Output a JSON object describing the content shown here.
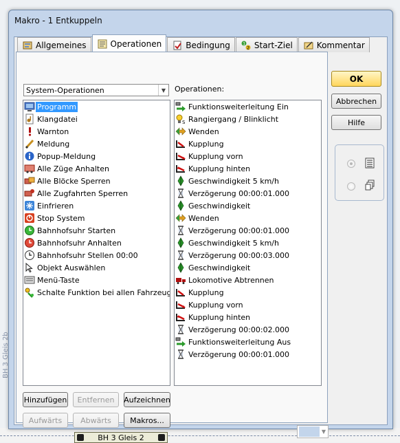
{
  "window": {
    "title": "Makro - 1 Entkuppeln"
  },
  "tabs": [
    {
      "label": "Allgemeines",
      "icon": "general-icon"
    },
    {
      "label": "Operationen",
      "icon": "operations-icon",
      "active": true
    },
    {
      "label": "Bedingung",
      "icon": "condition-icon"
    },
    {
      "label": "Start-Ziel",
      "icon": "start-destination-icon"
    },
    {
      "label": "Kommentar",
      "icon": "comment-icon"
    }
  ],
  "category_select": {
    "value": "System-Operationen"
  },
  "operations_label": "Operationen:",
  "system_operations": [
    {
      "label": "Programm",
      "icon": "program-icon",
      "selected": true
    },
    {
      "label": "Klangdatei",
      "icon": "sound-file-icon"
    },
    {
      "label": "Warnton",
      "icon": "warning-tone-icon"
    },
    {
      "label": "Meldung",
      "icon": "message-icon"
    },
    {
      "label": "Popup-Meldung",
      "icon": "popup-message-icon"
    },
    {
      "label": "Alle Züge Anhalten",
      "icon": "stop-all-trains-icon"
    },
    {
      "label": "Alle Blöcke Sperren",
      "icon": "lock-all-blocks-icon"
    },
    {
      "label": "Alle Zugfahrten Sperren",
      "icon": "lock-all-routes-icon"
    },
    {
      "label": "Einfrieren",
      "icon": "freeze-icon"
    },
    {
      "label": "Stop System",
      "icon": "stop-system-icon"
    },
    {
      "label": "Bahnhofsuhr Starten",
      "icon": "clock-start-icon"
    },
    {
      "label": "Bahnhofsuhr Anhalten",
      "icon": "clock-stop-icon"
    },
    {
      "label": "Bahnhofsuhr Stellen 00:00",
      "icon": "clock-set-icon"
    },
    {
      "label": "Objekt Auswählen",
      "icon": "select-object-icon"
    },
    {
      "label": "Menü-Taste",
      "icon": "menu-key-icon"
    },
    {
      "label": "Schalte Funktion bei allen Fahrzeugen",
      "icon": "switch-function-icon"
    }
  ],
  "operations": [
    {
      "label": "Funktionsweiterleitung Ein",
      "icon": "function-forwarding-icon"
    },
    {
      "label": "Rangiergang / Blinklicht",
      "icon": "shunting-light-icon"
    },
    {
      "label": "Wenden",
      "icon": "reverse-icon"
    },
    {
      "label": "Kupplung",
      "icon": "coupling-icon"
    },
    {
      "label": "Kupplung vorn",
      "icon": "coupling-front-icon"
    },
    {
      "label": "Kupplung hinten",
      "icon": "coupling-rear-icon"
    },
    {
      "label": "Geschwindigkeit 5 km/h",
      "icon": "speed-icon"
    },
    {
      "label": "Verzögerung 00:00:01.000",
      "icon": "delay-hourglass-icon"
    },
    {
      "label": "Geschwindigkeit",
      "icon": "speed-icon"
    },
    {
      "label": "Wenden",
      "icon": "reverse-icon"
    },
    {
      "label": "Verzögerung 00:00:01.000",
      "icon": "delay-hourglass-icon"
    },
    {
      "label": "Geschwindigkeit 5 km/h",
      "icon": "speed-icon"
    },
    {
      "label": "Verzögerung 00:00:03.000",
      "icon": "delay-hourglass-icon"
    },
    {
      "label": "Geschwindigkeit",
      "icon": "speed-icon"
    },
    {
      "label": "Lokomotive Abtrennen",
      "icon": "detach-locomotive-icon"
    },
    {
      "label": "Kupplung",
      "icon": "coupling-icon"
    },
    {
      "label": "Kupplung vorn",
      "icon": "coupling-front-icon"
    },
    {
      "label": "Kupplung hinten",
      "icon": "coupling-rear-icon"
    },
    {
      "label": "Verzögerung 00:00:02.000",
      "icon": "delay-hourglass-icon"
    },
    {
      "label": "Funktionsweiterleitung Aus",
      "icon": "function-forwarding-icon"
    },
    {
      "label": "Verzögerung 00:00:01.000",
      "icon": "delay-hourglass-icon"
    }
  ],
  "buttons": {
    "ok": "OK",
    "cancel": "Abbrechen",
    "help": "Hilfe",
    "add": "Hinzufügen",
    "remove": "Entfernen",
    "record": "Aufzeichnen",
    "up": "Aufwärts",
    "down": "Abwärts",
    "macros": "Makros..."
  },
  "background": {
    "track_label": "BH 3 Gleis 2",
    "side_label": "BH 3 Gleis 2b"
  },
  "colors": {
    "selection": "#3399ff",
    "ok_button": "#ffd65c",
    "annotation_arrow": "#e00000"
  }
}
